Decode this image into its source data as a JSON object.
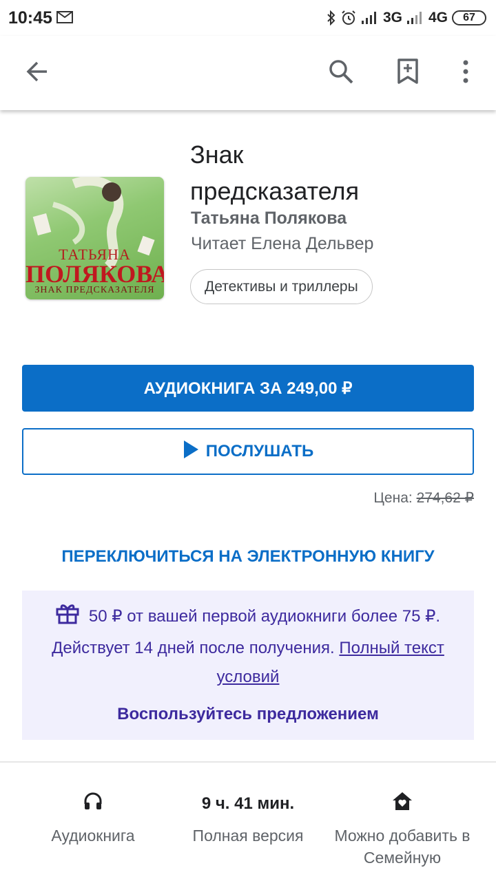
{
  "status_bar": {
    "time": "10:45",
    "network_1": "3G",
    "network_2": "4G",
    "battery": "67",
    "icons": [
      "mail-icon",
      "bluetooth-icon",
      "alarm-icon",
      "signal-icon",
      "battery-icon"
    ]
  },
  "app_bar": {
    "icons": [
      "back-arrow-icon",
      "search-icon",
      "bookmark-add-icon",
      "more-vert-icon"
    ]
  },
  "book": {
    "cover": {
      "author_line1": "ТАТЬЯНА",
      "author_line2": "ПОЛЯКОВА",
      "title_line": "ЗНАК ПРЕДСКАЗАТЕЛЯ"
    },
    "title_line1": "Знак",
    "title_line2": "предсказателя",
    "author": "Татьяна Полякова",
    "reader": "Читает Елена Дельвер",
    "genre": "Детективы и триллеры"
  },
  "actions": {
    "buy_label": "АУДИОКНИГА ЗА 249,00 ₽",
    "listen_label": "ПОСЛУШАТЬ",
    "price_label": "Цена:",
    "price_old": "274,62 ₽",
    "switch_label": "ПЕРЕКЛЮЧИТЬСЯ НА ЭЛЕКТРОННУЮ КНИГУ"
  },
  "promo": {
    "text": "50 ₽ от вашей первой аудиокниги более 75 ₽. Действует 14 дней после получения.",
    "link": "Полный текст условий",
    "cta": "Воспользуйтесь предложением"
  },
  "info": {
    "type_label": "Аудиокнига",
    "duration": "9 ч. 41 мин.",
    "version_label": "Полная версия",
    "family_label": "Можно добавить в Семейную"
  },
  "colors": {
    "primary": "#0b6ec7",
    "promo_bg": "#f1f0fd",
    "promo_text": "#3d2a9e"
  }
}
